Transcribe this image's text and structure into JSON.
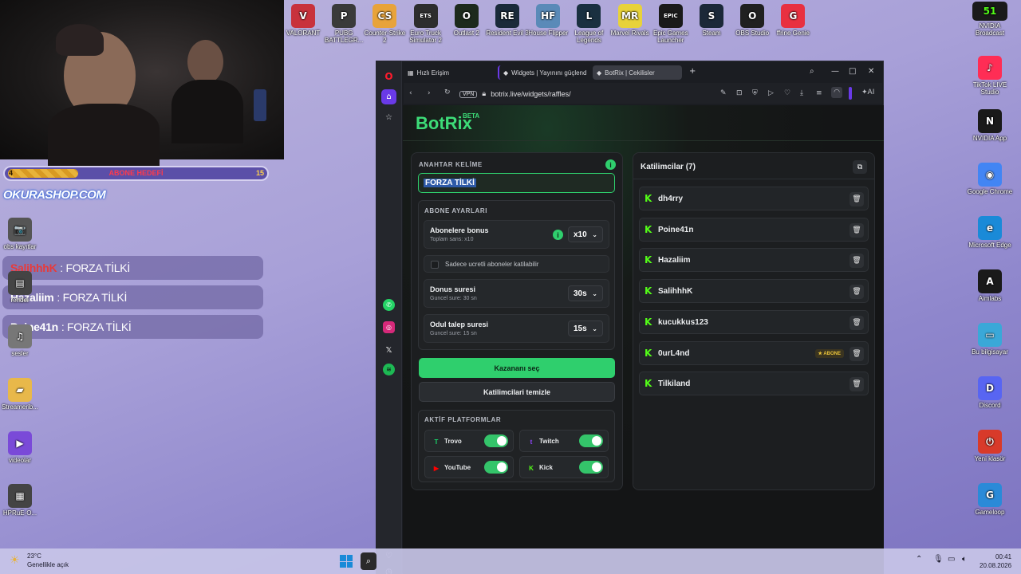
{
  "desktop": {
    "top_icons": [
      {
        "label": "VALORANT",
        "icon": "valorant-icon",
        "color": "#c8323c",
        "glyph": "V"
      },
      {
        "label": "PUBG BATTLEGR...",
        "icon": "pubg-icon",
        "color": "#3a3a3a",
        "glyph": "P"
      },
      {
        "label": "Counter-Strike 2",
        "icon": "counter-strike-icon",
        "color": "#e8a33a",
        "glyph": "CS"
      },
      {
        "label": "Euro Truck Simulator 2",
        "icon": "truck-icon",
        "color": "#2d2d2d",
        "glyph": "ETS"
      },
      {
        "label": "Outlast 2",
        "icon": "outlast-icon",
        "color": "#1d2a1c",
        "glyph": "O"
      },
      {
        "label": "Resident Evil 3",
        "icon": "resident-evil-icon",
        "color": "#1a2a3a",
        "glyph": "RE"
      },
      {
        "label": "House Flipper",
        "icon": "house-flipper-icon",
        "color": "#5a8ab8",
        "glyph": "HF"
      },
      {
        "label": "League of Legends",
        "icon": "league-icon",
        "color": "#1a3040",
        "glyph": "L"
      },
      {
        "label": "Marvel Rivals",
        "icon": "marvel-rivals-icon",
        "color": "#e8d23a",
        "glyph": "MR"
      },
      {
        "label": "Epic Games Launcher",
        "icon": "epic-games-icon",
        "color": "#1a1a1a",
        "glyph": "EPIC"
      },
      {
        "label": "Steam",
        "icon": "steam-icon",
        "color": "#1b2838",
        "glyph": "S"
      },
      {
        "label": "OBS Studio",
        "icon": "obs-icon",
        "color": "#202020",
        "glyph": "O"
      },
      {
        "label": "ffrine Genie",
        "icon": "genie-icon",
        "color": "#e83040",
        "glyph": "G"
      }
    ],
    "right_icons": [
      {
        "label": "NVIDIA Broadcast",
        "icon": "kick-badge-icon",
        "color": "#1a1a1a",
        "glyph": "51"
      },
      {
        "label": "TikTok LIVE Studio",
        "icon": "tiktok-icon",
        "color": "#ff2d55",
        "glyph": "♪"
      },
      {
        "label": "NVIDIA App",
        "icon": "nvidia-icon",
        "color": "#1a1a1a",
        "glyph": "N"
      },
      {
        "label": "Google Chrome",
        "icon": "chrome-icon",
        "color": "#4285f4",
        "glyph": "◉"
      },
      {
        "label": "Microsoft Edge",
        "icon": "edge-icon",
        "color": "#1a8ad8",
        "glyph": "e"
      },
      {
        "label": "Aimlabs",
        "icon": "aimlabs-icon",
        "color": "#1a1a1a",
        "glyph": "A"
      },
      {
        "label": "Bu bilgisayar",
        "icon": "computer-icon",
        "color": "#3aa8d8",
        "glyph": "▭"
      },
      {
        "label": "Discord",
        "icon": "discord-icon",
        "color": "#5865f2",
        "glyph": "D"
      },
      {
        "label": "Yeni klasör",
        "icon": "new-folder-icon",
        "color": "#d83a2a",
        "glyph": "⏻"
      },
      {
        "label": "Gameloop",
        "icon": "gameloop-icon",
        "color": "#2a8ad8",
        "glyph": "G"
      }
    ],
    "left_icons": [
      {
        "label": "obs kayıtlar",
        "icon": "camera-icon",
        "color": "#555",
        "glyph": "📷"
      },
      {
        "label": "render",
        "icon": "film-icon",
        "color": "#444",
        "glyph": "▤"
      },
      {
        "label": "sesler",
        "icon": "audio-icon",
        "color": "#777",
        "glyph": "♫"
      },
      {
        "label": "Streamerib...",
        "icon": "folder-icon",
        "color": "#e8b84a",
        "glyph": "▰"
      },
      {
        "label": "videolar",
        "icon": "video-folder-icon",
        "color": "#7a4ad8",
        "glyph": "▶"
      },
      {
        "label": "HPRuE-O...",
        "icon": "drive-icon",
        "color": "#444",
        "glyph": "▦"
      }
    ]
  },
  "overlay": {
    "goal_current": "4",
    "goal_label": "ABONE HEDEFİ",
    "goal_target": "15",
    "goal_progress": 0.27,
    "shop": "OKURASHOP.COM",
    "chat": [
      {
        "user": "SalihhhK",
        "msg": ": FORZA TİLKİ",
        "user_color": "#e83a3a"
      },
      {
        "user": "Hazaliim",
        "msg": ": FORZA TİLKİ",
        "user_color": "#ffffff"
      },
      {
        "user": "Poine41n",
        "msg": ": FORZA TİLKİ",
        "user_color": "#ffffff"
      }
    ]
  },
  "browser": {
    "tabs": [
      "Hızlı Erişim",
      "Widgets | Yayınını güçlend",
      "BotRix | Cekilisler"
    ],
    "vpn": "VPN",
    "url": "botrix.live/widgets/raffles/",
    "ai": "AI"
  },
  "botrix": {
    "logo": "BotRix",
    "beta": "BETA",
    "keyword_label": "ANAHTAR KELİME",
    "keyword_value": "FORZA TİLKİ",
    "sub_settings_label": "ABONE AYARLARI",
    "bonus_title": "Abonelere bonus",
    "bonus_sub": "Toplam sans: x10",
    "bonus_value": "x10",
    "paid_only": "Sadece ucretli aboneler katilabilir",
    "donus_title": "Donus suresi",
    "donus_sub": "Guncel sure: 30 sn",
    "donus_value": "30s",
    "odul_title": "Odul talep suresi",
    "odul_sub": "Guncel sure: 15 sn",
    "odul_value": "15s",
    "pick_winner": "Kazananı seç",
    "clear_participants": "Katilimcilari temizle",
    "platforms_label": "AKTİF PLATFORMLAR",
    "platforms": [
      {
        "name": "Trovo",
        "color": "#19d66b",
        "glyph": "T",
        "on": true
      },
      {
        "name": "Twitch",
        "color": "#9146ff",
        "glyph": "t",
        "on": true
      },
      {
        "name": "YouTube",
        "color": "#ff0000",
        "glyph": "▶",
        "on": true
      },
      {
        "name": "Kick",
        "color": "#53fc18",
        "glyph": "K",
        "on": true
      }
    ],
    "participants_title": "Katilimcilar (7)",
    "participants": [
      "dh4rry",
      "Poine41n",
      "Hazaliim",
      "SalihhhK",
      "kucukkus123",
      "0urL4nd",
      "Tilkiland"
    ],
    "sub_badge": "★ ABONE"
  },
  "taskbar": {
    "temp": "23°C",
    "weather": "Genellikle açık",
    "time": "00:41",
    "date": "20.08.2026"
  },
  "colors": {
    "accent": "#2fcf6d",
    "kick": "#53fc18"
  }
}
